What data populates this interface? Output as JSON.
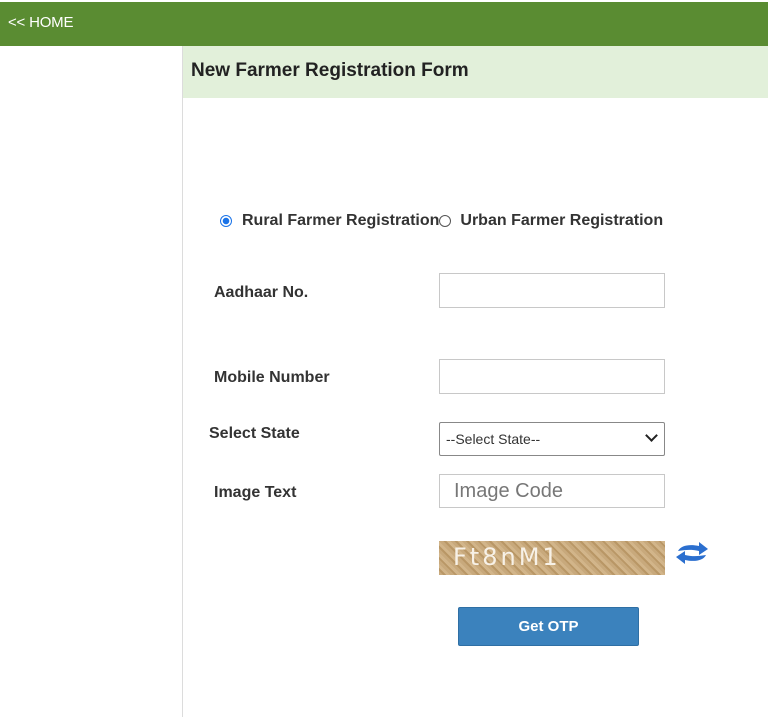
{
  "nav": {
    "home_label": "<< HOME"
  },
  "form": {
    "title": "New Farmer Registration Form",
    "registration_type": {
      "options": [
        "Rural Farmer Registration",
        "Urban Farmer Registration"
      ],
      "selected": "Rural Farmer Registration"
    },
    "aadhaar": {
      "label": "Aadhaar No.",
      "value": ""
    },
    "mobile": {
      "label": "Mobile Number",
      "value": ""
    },
    "state": {
      "label": "Select State",
      "selected": "--Select State--"
    },
    "image_text": {
      "label": "Image Text",
      "placeholder": "Image Code",
      "captcha": "Ft8nM1"
    },
    "submit_label": "Get OTP"
  },
  "colors": {
    "topbar": "#5a8c32",
    "header_bg": "#e2f0da",
    "button": "#3b82bd",
    "refresh_icon": "#2b6fcf"
  },
  "icons": {
    "refresh": "refresh-arrows-icon",
    "dropdown": "chevron-down-icon"
  }
}
